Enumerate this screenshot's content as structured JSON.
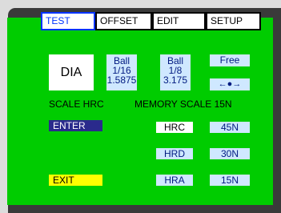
{
  "tabs": [
    "TEST",
    "OFFSET",
    "EDIT",
    "SETUP"
  ],
  "dia": "DIA",
  "ball_16": {
    "name": "Ball",
    "frac": "1/16",
    "mm": "1.5875"
  },
  "ball_8": {
    "name": "Ball",
    "frac": "1/8",
    "mm": "3.175"
  },
  "free_label": "Free",
  "arrows": "←●→",
  "labels": {
    "scale_hrc": "SCALE HRC",
    "memory_scale": "MEMORY SCALE  15N"
  },
  "enter": "ENTER",
  "exit": "EXIT",
  "scales": {
    "hrc": "HRC",
    "hrd": "HRD",
    "hra": "HRA",
    "n45": "45N",
    "n30": "30N",
    "n15": "15N"
  },
  "colors": {
    "active_tab": "#0033ff",
    "enter_bg": "#2a2a8c",
    "exit_bg": "#ffff00",
    "screen": "#00cc00"
  }
}
